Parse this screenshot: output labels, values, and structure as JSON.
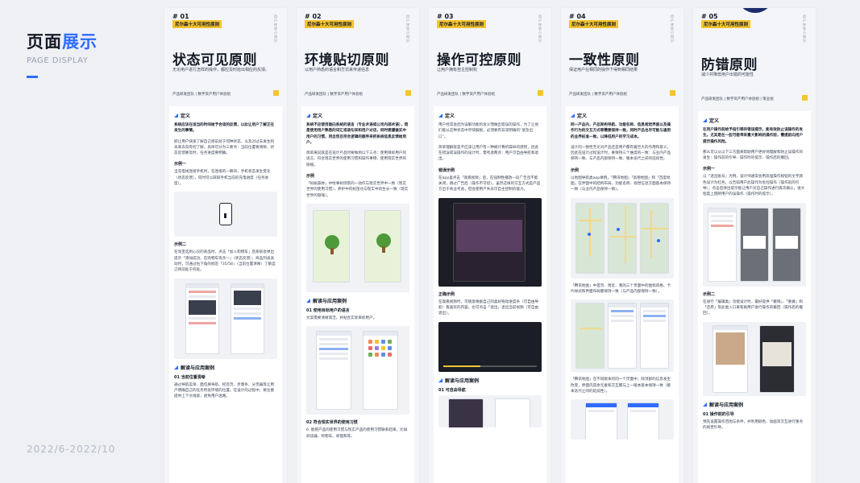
{
  "page": {
    "title_part1": "页面",
    "title_part2": "展示",
    "subtitle": "PAGE DISPLAY",
    "date": "2022/6-2022/10"
  },
  "colors": {
    "accent": "#2f6bff",
    "tag": "#f5c431",
    "dark": "#141a26"
  },
  "cards": [
    {
      "num": "# 01",
      "tag": "尼尔森十大可用性原则",
      "side": "用户体验小知识",
      "title": "状态可见原则",
      "desc": "无论用户进行怎样的操作，都应及时给出相应的反馈。",
      "team": "产品研发团队 | 数字资产用户体验组",
      "sections": {
        "def_title": "定义",
        "def_p1": "系统应该在适当的时间给予合适的反馈，以此让用户了解正在发生的事情。",
        "def_p2": "即让用户快速了解自己目前处于何种状态，以及对过去发生和未来去向有何了解。具体可分为三要点：当前位置要清晰、状态反馈要及时、任务进度要明确。",
        "ex1_title": "示例一",
        "ex1_p": "当充电线连接手机时，在连接的一瞬间，手机状态发生变化（状态反馈），同时可以获取手机当前的充电进度（任务进度）。",
        "ex2_title": "示例二",
        "ex2_p": "在淘宝选到心仪的商品时，点击「加入购物车」后系统会弹出提示「添加成功，在购物车等亲～」（状态反馈），商品列表滚动时，可通过右下角的标签「35/58」（当前位置清晰）了解自己目前处于何处。",
        "app_title": "解读与应用案例",
        "app_sub": "01 当前位置清晰",
        "app_p": "通过导航菜单、面包屑导航、标签页、步骤条、分页器等让用户明确自己的任务所处环境的位置。在设计的过程中，要注重提供上下文线索，避免用户迷路。"
      }
    },
    {
      "num": "# 02",
      "tag": "尼尔森十大可用性原则",
      "side": "用户体验小知识",
      "title": "环境贴切原则",
      "desc": "以用户熟悉的语言和方式来传递信息",
      "team": "产品研发团队 | 数字资产用户体验组",
      "sections": {
        "def_title": "定义",
        "def_p1": "系统不应使用面向系统的语言（专业术语或公司内部术语），而是使用用户熟悉的词汇或语句来和用户对话，同时要遵循实中用户的习惯，用自然且符合逻辑的顺序来把系统信息反馈给用户。",
        "def_p2": "简单来说就是在设计产品时要做到以下三点：使用目标用户的语言、符合现实世界的使用习惯和操作事物、使用现实世界的隐喻。",
        "ex1_title": "示例",
        "ex1_p": "「蚂蚁森林」中绘事树场景的一动作与现实世界中一致（现实世界的使用习惯），养护中的树苗也与现实中的生长一致（现实世界的隐喻）。",
        "app_title": "解读与应用案例",
        "app_sub": "01 使用目标用户的语言",
        "app_p": "文案需要清晰简洁，并贴合实际目标用户。",
        "app_sub2": "02 符合现实世界的使用习惯",
        "app_p2": "6. 能把产品的使用习惯与现实产品的使用习惯联系起来，比如阅读器、购物车、易理和等。"
      }
    },
    {
      "num": "# 03",
      "tag": "尼尔森十大可用性原则",
      "side": "用户体验小知识",
      "title": "操作可控原则",
      "desc": "让用户拥有自主控制权",
      "team": "产品研发团队 | 数字资产用户体验组",
      "sections": {
        "def_title": "定义",
        "def_p1": "用户经常会因为误解功能的含义而做出错误的操作，为了让他们能从这种状态中尽快解脱，必须要有非常明确的“紧急出口”。",
        "def_p2": "简单理解就是不应该让用户有一种被计算机操纵的感觉，因此在错误或误操作的设计时，需考虑两点：用户可自由导航和退出。",
        "ex1_title": "错误示例",
        "ex1_p": "在app里点击「观看视频」后，在强制性播放一段广告且不能关闭，跳过广告后（操作不可控）。虽然这样的交互方式是产品方出于商业考虑，但会使用户失去可自主控制的能力。",
        "ex2_title": "正确示例",
        "ex2_p": "在观看视频时，可随意根据自己的喜好拖动进度条（可自由导航）看喜欢的内容，也可点击「退出」退出当前视频（可自由退出）。",
        "app_title": "解读与应用案例",
        "app_sub": "01 可自由导航"
      }
    },
    {
      "num": "# 04",
      "tag": "尼尔森十大可用性原则",
      "side": "用户体验小知识",
      "title": "一致性原则",
      "desc": "保证用户在相同的操作下得到相同结果",
      "team": "产品研发团队 | 数字资产用户体验组",
      "sections": {
        "def_title": "定义",
        "def_p1": "同一产品内，产品架构导航、功能名称、信息视觉界面以及操作行为的交互方式等需要保持一致，同时产品也尽可能与通用的业界标准一致，以降低用户的学习成本。",
        "def_p2": "设计的一致性无论对产品还是用户都有着巨大的作用和意义。因此在设计过程设计时，要保持三个维度的一致：与业内产品保持一致、与产品内部保持一致、版本迭代之间的延续性。",
        "ex1_title": "示例",
        "ex1_p": "以地图导航类app举例，「腾讯地图」「高德地图」和「百度地图」在界面中的结构布局、功能名称、视觉信息方面基本保持一致（与业内产品保持一致）。",
        "ex2_p": "「腾讯地图」中首页、附近、我的三个页面中的图标风格、卡片样式和界面布局都保持一致（与产品内部保持一致）。",
        "ex3_p": "「腾讯地图」在不同版本的同一个页面中，除顶部的信息发生改变，界面内其余元素和交互都与上一版本基本保持一致（版本迭代之间的延续性）。"
      }
    },
    {
      "num": "# 05",
      "tag": "尼尔森十大可用性原则",
      "side": "用户体验小知识",
      "title": "防错原则",
      "desc": "减少并降低用户出错的可能性",
      "team": "产品研发团队 | 数字资产用户体验组 | 策业组",
      "sections": {
        "def_title": "定义",
        "def_p1": "在用户操作前给予指引等的错误提示，能有效防止误操作的发生。尤其是在一些可能带来重大影响的操作前，需提前向用户提示操作风险。",
        "def_p2": "那么可以从以下三方面来帮助用户更好地理解和防止误操作的发生：操作前的引导、操作时的提示、操作后的撤回。",
        "ex1_title": "示例一",
        "ex1_p": "以「退出账号」为例，设计师通常会用高强操作按钮的文字颜色设计为红色，以告知用户此操作为危险操作（操作前的引导）；点击后弹出提示框让用户对自己操作进行再次确认，很大程度上阻断用户的误操作（操作时的提示）。",
        "ex2_title": "示例二",
        "ex2_p": "在进行「编辑类」功能设计时，最好提供「撤销」、「重做」和「还原」等此类入口来帮助用户进行操作的撤回（操作后的撤回）。",
        "app_title": "解读与应用案例",
        "app_sub": "01 操作前的引导",
        "app_p": "预先设置操作范围与条件，并利用颜色、动画等交互进行重点的视觉引导。"
      }
    }
  ]
}
